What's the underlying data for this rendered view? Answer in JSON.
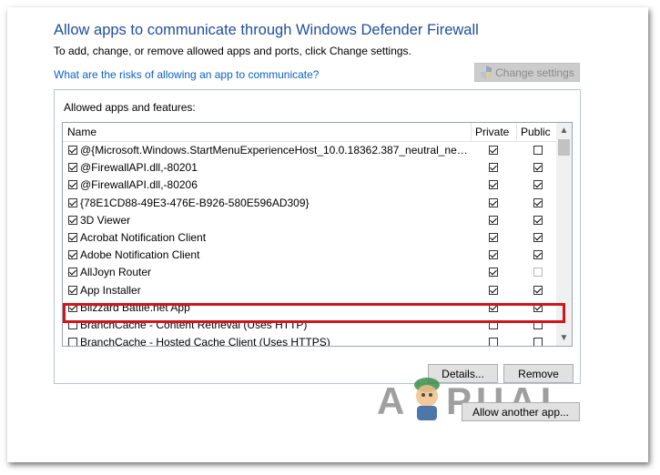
{
  "title": "Allow apps to communicate through Windows Defender Firewall",
  "subtitle": "To add, change, or remove allowed apps and ports, click Change settings.",
  "risk_link": "What are the risks of allowing an app to communicate?",
  "change_settings_label": "Change settings",
  "group_label": "Allowed apps and features:",
  "columns": {
    "name": "Name",
    "private": "Private",
    "public": "Public"
  },
  "rows": [
    {
      "name": "@{Microsoft.Windows.StartMenuExperienceHost_10.0.18362.387_neutral_neutra...",
      "enabled": true,
      "private": true,
      "public": false
    },
    {
      "name": "@FirewallAPI.dll,-80201",
      "enabled": true,
      "private": true,
      "public": true
    },
    {
      "name": "@FirewallAPI.dll,-80206",
      "enabled": true,
      "private": true,
      "public": true
    },
    {
      "name": "{78E1CD88-49E3-476E-B926-580E596AD309}",
      "enabled": true,
      "private": true,
      "public": true
    },
    {
      "name": "3D Viewer",
      "enabled": true,
      "private": true,
      "public": true
    },
    {
      "name": "Acrobat Notification Client",
      "enabled": true,
      "private": true,
      "public": true
    },
    {
      "name": "Adobe Notification Client",
      "enabled": true,
      "private": true,
      "public": true
    },
    {
      "name": "AllJoyn Router",
      "enabled": true,
      "private": true,
      "public": false
    },
    {
      "name": "App Installer",
      "enabled": true,
      "private": true,
      "public": true
    },
    {
      "name": "Blizzard Battle.net App",
      "enabled": true,
      "private": true,
      "public": true
    },
    {
      "name": "BranchCache - Content Retrieval (Uses HTTP)",
      "enabled": false,
      "private": false,
      "public": false
    },
    {
      "name": "BranchCache - Hosted Cache Client (Uses HTTPS)",
      "enabled": false,
      "private": false,
      "public": false
    }
  ],
  "buttons": {
    "details": "Details...",
    "remove": "Remove",
    "allow_another": "Allow another app..."
  },
  "watermark": "APPUALS",
  "colors": {
    "title": "#1f4e9c",
    "link": "#0a61c6",
    "highlight": "#d3141a"
  }
}
